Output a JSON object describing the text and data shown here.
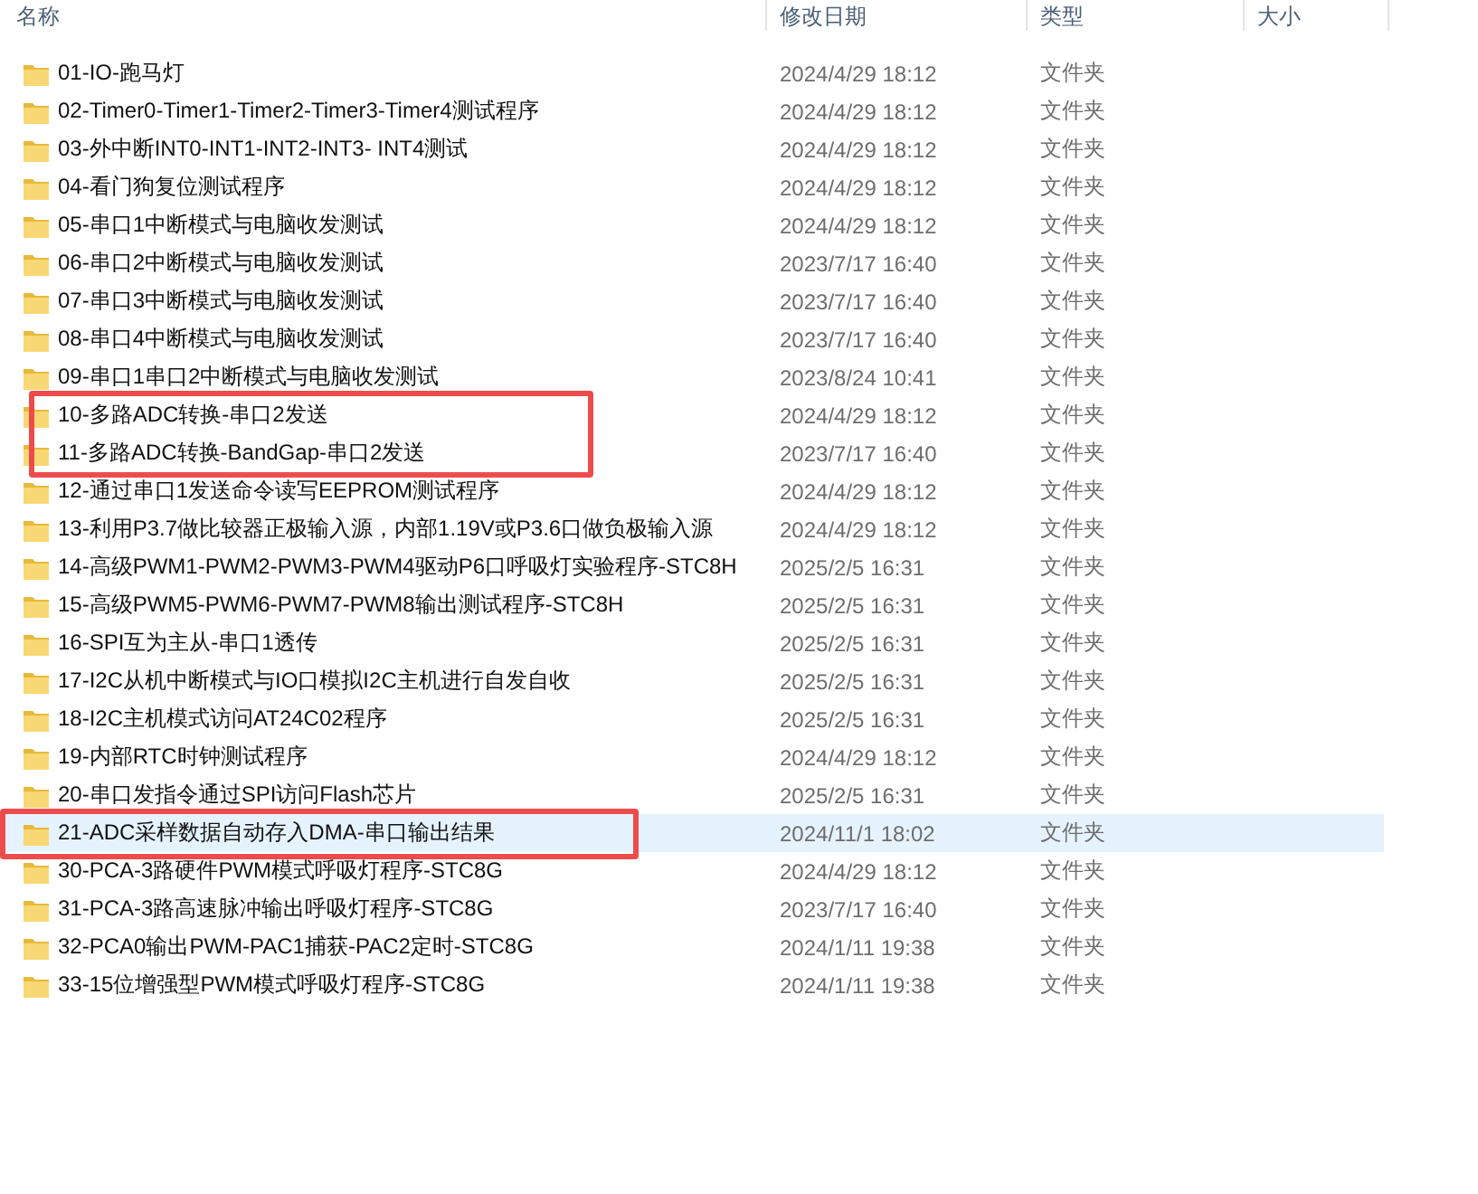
{
  "columns": [
    {
      "label": "名称"
    },
    {
      "label": "修改日期"
    },
    {
      "label": "类型"
    },
    {
      "label": "大小"
    }
  ],
  "rows": [
    {
      "name": "01-IO-跑马灯",
      "date": "2024/4/29 18:12",
      "type": "文件夹",
      "hovered": false,
      "marked": false
    },
    {
      "name": "02-Timer0-Timer1-Timer2-Timer3-Timer4测试程序",
      "date": "2024/4/29 18:12",
      "type": "文件夹",
      "hovered": false,
      "marked": false
    },
    {
      "name": "03-外中断INT0-INT1-INT2-INT3- INT4测试",
      "date": "2024/4/29 18:12",
      "type": "文件夹",
      "hovered": false,
      "marked": false
    },
    {
      "name": "04-看门狗复位测试程序",
      "date": "2024/4/29 18:12",
      "type": "文件夹",
      "hovered": false,
      "marked": false
    },
    {
      "name": "05-串口1中断模式与电脑收发测试",
      "date": "2024/4/29 18:12",
      "type": "文件夹",
      "hovered": false,
      "marked": false
    },
    {
      "name": "06-串口2中断模式与电脑收发测试",
      "date": "2023/7/17 16:40",
      "type": "文件夹",
      "hovered": false,
      "marked": false
    },
    {
      "name": "07-串口3中断模式与电脑收发测试",
      "date": "2023/7/17 16:40",
      "type": "文件夹",
      "hovered": false,
      "marked": false
    },
    {
      "name": "08-串口4中断模式与电脑收发测试",
      "date": "2023/7/17 16:40",
      "type": "文件夹",
      "hovered": false,
      "marked": false
    },
    {
      "name": "09-串口1串口2中断模式与电脑收发测试",
      "date": "2023/8/24 10:41",
      "type": "文件夹",
      "hovered": false,
      "marked": false
    },
    {
      "name": "10-多路ADC转换-串口2发送",
      "date": "2024/4/29 18:12",
      "type": "文件夹",
      "hovered": false,
      "marked": true
    },
    {
      "name": "11-多路ADC转换-BandGap-串口2发送",
      "date": "2023/7/17 16:40",
      "type": "文件夹",
      "hovered": false,
      "marked": true
    },
    {
      "name": "12-通过串口1发送命令读写EEPROM测试程序",
      "date": "2024/4/29 18:12",
      "type": "文件夹",
      "hovered": false,
      "marked": false
    },
    {
      "name": "13-利用P3.7做比较器正极输入源，内部1.19V或P3.6口做负极输入源",
      "date": "2024/4/29 18:12",
      "type": "文件夹",
      "hovered": false,
      "marked": false
    },
    {
      "name": "14-高级PWM1-PWM2-PWM3-PWM4驱动P6口呼吸灯实验程序-STC8H",
      "date": "2025/2/5 16:31",
      "type": "文件夹",
      "hovered": false,
      "marked": false
    },
    {
      "name": "15-高级PWM5-PWM6-PWM7-PWM8输出测试程序-STC8H",
      "date": "2025/2/5 16:31",
      "type": "文件夹",
      "hovered": false,
      "marked": false
    },
    {
      "name": "16-SPI互为主从-串口1透传",
      "date": "2025/2/5 16:31",
      "type": "文件夹",
      "hovered": false,
      "marked": false
    },
    {
      "name": "17-I2C从机中断模式与IO口模拟I2C主机进行自发自收",
      "date": "2025/2/5 16:31",
      "type": "文件夹",
      "hovered": false,
      "marked": false
    },
    {
      "name": "18-I2C主机模式访问AT24C02程序",
      "date": "2025/2/5 16:31",
      "type": "文件夹",
      "hovered": false,
      "marked": false
    },
    {
      "name": "19-内部RTC时钟测试程序",
      "date": "2024/4/29 18:12",
      "type": "文件夹",
      "hovered": false,
      "marked": false
    },
    {
      "name": "20-串口发指令通过SPI访问Flash芯片",
      "date": "2025/2/5 16:31",
      "type": "文件夹",
      "hovered": false,
      "marked": false
    },
    {
      "name": "21-ADC采样数据自动存入DMA-串口输出结果",
      "date": "2024/11/1 18:02",
      "type": "文件夹",
      "hovered": true,
      "marked": true
    },
    {
      "name": "30-PCA-3路硬件PWM模式呼吸灯程序-STC8G",
      "date": "2024/4/29 18:12",
      "type": "文件夹",
      "hovered": false,
      "marked": false
    },
    {
      "name": "31-PCA-3路高速脉冲输出呼吸灯程序-STC8G",
      "date": "2023/7/17 16:40",
      "type": "文件夹",
      "hovered": false,
      "marked": false
    },
    {
      "name": "32-PCA0输出PWM-PAC1捕获-PAC2定时-STC8G",
      "date": "2024/1/11 19:38",
      "type": "文件夹",
      "hovered": false,
      "marked": false
    },
    {
      "name": "33-15位增强型PWM模式呼吸灯程序-STC8G",
      "date": "2024/1/11 19:38",
      "type": "文件夹",
      "hovered": false,
      "marked": false
    }
  ]
}
